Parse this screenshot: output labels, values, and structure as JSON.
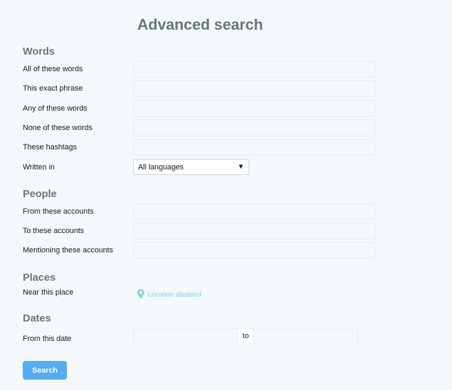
{
  "page_title": "Advanced search",
  "sections": {
    "words": {
      "title": "Words",
      "all_words_label": "All of these words",
      "exact_phrase_label": "This exact phrase",
      "any_words_label": "Any of these words",
      "none_words_label": "None of these words",
      "hashtags_label": "These hashtags",
      "written_in_label": "Written in",
      "language_selected": "All languages"
    },
    "people": {
      "title": "People",
      "from_label": "From these accounts",
      "to_label": "To these accounts",
      "mentioning_label": "Mentioning these accounts"
    },
    "places": {
      "title": "Places",
      "near_label": "Near this place",
      "location_status": "Location disabled",
      "location_icon": "map-pin-icon"
    },
    "dates": {
      "title": "Dates",
      "from_label": "From this date",
      "separator": "to"
    }
  },
  "search_button_label": "Search",
  "colors": {
    "background": "#f5f8fa",
    "heading": "#66757f",
    "accent": "#55acee",
    "location": "#8ecde6"
  }
}
